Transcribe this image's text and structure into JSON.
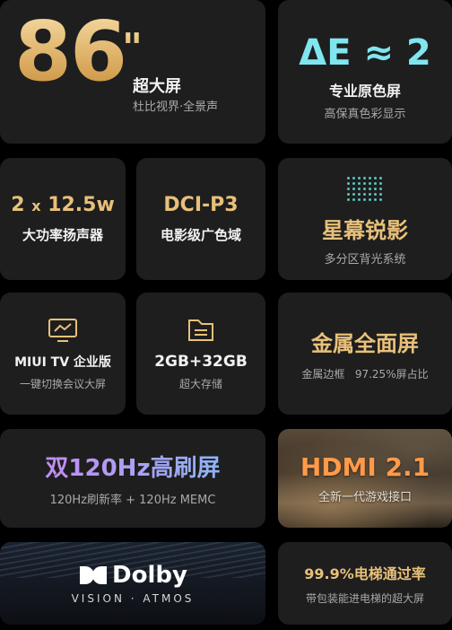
{
  "screen": {
    "size": {
      "value": "86",
      "unit": "\"",
      "title": "超大屏",
      "subtitle": "杜比视界·全景声"
    },
    "color": {
      "value": "ΔE ≈ 2",
      "title": "专业原色屏",
      "subtitle": "高保真色彩显示"
    }
  },
  "audio": {
    "value_prefix": "2",
    "value_x": "x",
    "value_suffix": "12.5w",
    "title": "大功率扬声器"
  },
  "gamut": {
    "value": "DCI-P3",
    "title": "电影级广色域"
  },
  "dimming": {
    "title": "星幕锐影",
    "subtitle": "多分区背光系统"
  },
  "miui": {
    "icon": "chart-monitor-icon",
    "title": "MIUI TV 企业版",
    "subtitle": "一键切换会议大屏"
  },
  "storage": {
    "icon": "folder-icon",
    "title": "2GB+32GB",
    "subtitle": "超大存储"
  },
  "metal": {
    "title": "金属全面屏",
    "subtitle": "金属边框   97.25%屏占比"
  },
  "refresh": {
    "title": "双120Hz高刷屏",
    "subtitle": "120Hz刷新率 + 120Hz MEMC"
  },
  "hdmi": {
    "title": "HDMI 2.1",
    "subtitle": "全新一代游戏接口"
  },
  "dolby": {
    "brand": "Dolby",
    "subline": "VISION · ATMOS"
  },
  "elevator": {
    "title": "99.9%电梯通过率",
    "subtitle": "带包装能进电梯的超大屏"
  },
  "colors": {
    "gold": "#e8c07a",
    "card": "#1e1e1e",
    "background": "#000000",
    "purple": "#b98cf0",
    "cyan": "#7fe6f0"
  }
}
